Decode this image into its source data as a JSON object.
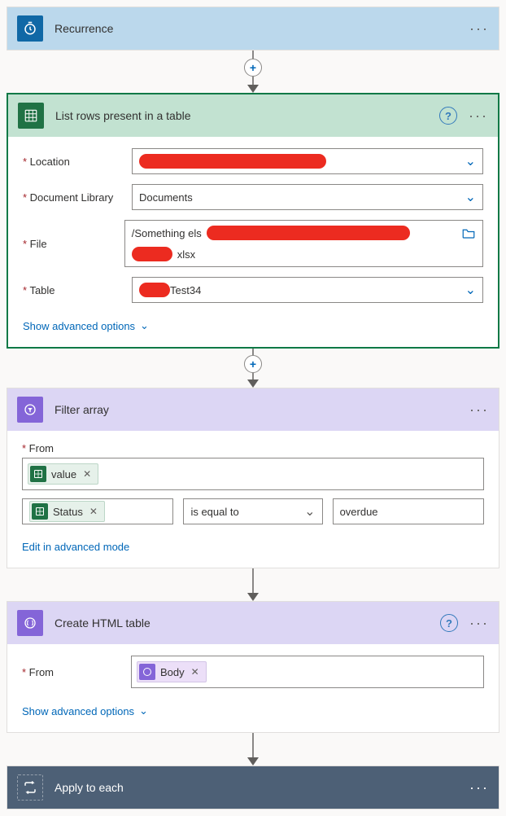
{
  "recurrence": {
    "title": "Recurrence"
  },
  "list_rows": {
    "title": "List rows present in a table",
    "fields": {
      "location": {
        "label": "Location"
      },
      "doclib": {
        "label": "Document Library",
        "value": "Documents"
      },
      "file": {
        "label": "File",
        "prefix": "/Something els",
        "suffix": "xlsx"
      },
      "table": {
        "label": "Table",
        "suffix": "Test34"
      }
    },
    "advanced_link": "Show advanced options"
  },
  "filter": {
    "title": "Filter array",
    "from_label": "From",
    "token_value": "value",
    "token_status": "Status",
    "operator": "is equal to",
    "compare_value": "overdue",
    "edit_link": "Edit in advanced mode"
  },
  "html_table": {
    "title": "Create HTML table",
    "from_label": "From",
    "body_token": "Body",
    "advanced_link": "Show advanced options"
  },
  "apply": {
    "title": "Apply to each"
  }
}
